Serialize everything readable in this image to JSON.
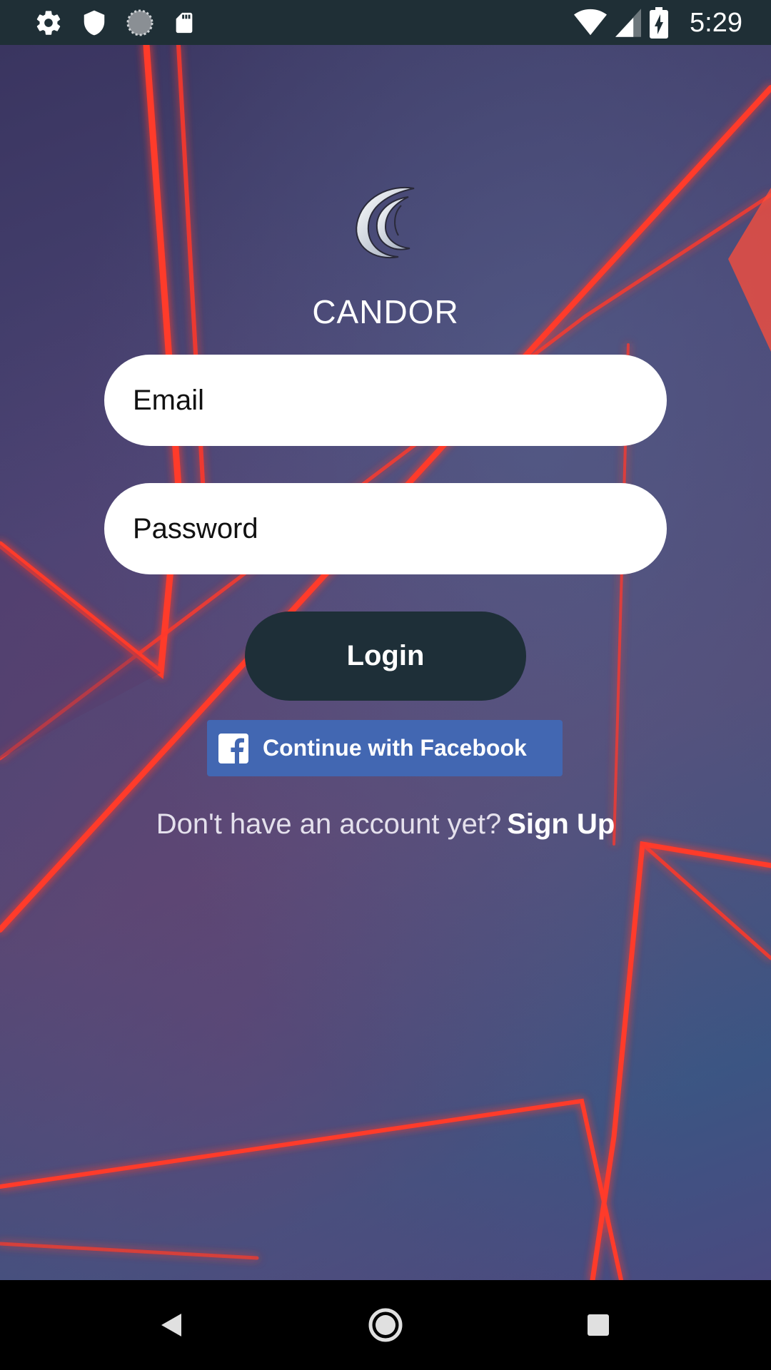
{
  "status_bar": {
    "time": "5:29",
    "left_icons": [
      "settings-icon",
      "shield-icon",
      "sync-icon",
      "sd-card-icon"
    ],
    "right_icons": [
      "wifi-icon",
      "signal-icon",
      "battery-charging-icon"
    ]
  },
  "app": {
    "brand_name": "CANDOR",
    "logo_icon": "candor-logo-icon"
  },
  "form": {
    "email_placeholder": "Email",
    "password_placeholder": "Password",
    "login_label": "Login",
    "facebook_label": "Continue with Facebook",
    "signup_prompt": "Don't have an account yet?",
    "signup_link": "Sign Up"
  },
  "nav_bar": {
    "buttons": [
      "back-icon",
      "home-icon",
      "recents-icon"
    ]
  },
  "colors": {
    "status_bar": "#1f2f36",
    "login_button": "#1e2f38",
    "facebook": "#4267b2",
    "field_background": "#ffffff"
  }
}
